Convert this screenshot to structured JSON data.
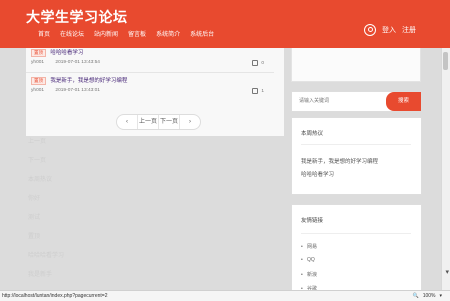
{
  "header": {
    "site_title": "大学生学习论坛",
    "nav": [
      "首页",
      "在线论坛",
      "站内新闻",
      "留言板",
      "系统简介",
      "系统后台"
    ],
    "login": "登入",
    "register": "注册"
  },
  "posts": [
    {
      "tag": "置顶",
      "title": "哈哈哈看学习",
      "user": "yh001",
      "time": "2019-07-01 13:43:54",
      "comments": "0"
    },
    {
      "tag": "置顶",
      "title": "我是新手，我是想的好学习编程",
      "user": "yh001",
      "time": "2019-07-01 13:43:01",
      "comments": "1"
    }
  ],
  "pagination": {
    "prev_icon": "‹",
    "prev": "上一页",
    "next": "下一页",
    "next_icon": "›"
  },
  "search": {
    "placeholder": "请输入关键词",
    "button": "搜索"
  },
  "hot": {
    "title": "本周热议",
    "items": [
      "我是新手，我是想的好学习编程",
      "哈哈哈看学习"
    ]
  },
  "links": {
    "title": "友情链接",
    "items": [
      "网易",
      "QQ",
      "新浪",
      "谷歌"
    ]
  },
  "status": {
    "url": "http://localhost/luntan/index.php?pagecurrent=2",
    "zoom": "100%"
  },
  "ghost": {
    "items": [
      "上一页",
      "下一页",
      "本周热议",
      "你好",
      "测试",
      "置顶",
      "哈哈哈看学习",
      "我是新手"
    ]
  }
}
